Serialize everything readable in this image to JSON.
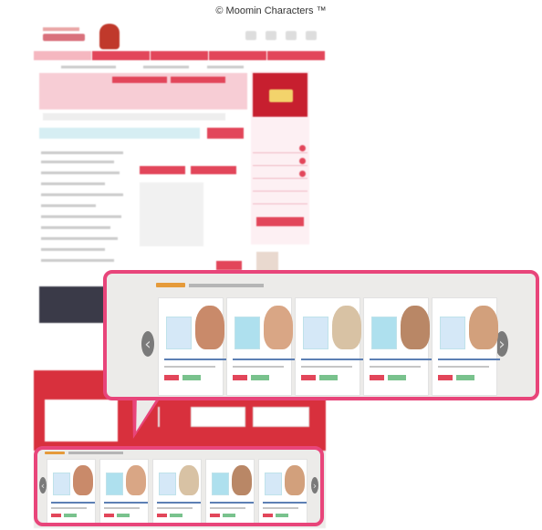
{
  "copyright": "© Moomin Characters ™",
  "colors": {
    "callout_border": "#e8457a",
    "site_red": "#e2465a",
    "panel_bg": "#ecebe9",
    "brand_orange": "#e59a3a"
  },
  "icons": {
    "carousel_prev": "chevron-left-icon",
    "carousel_next": "chevron-right-icon"
  },
  "carousel": {
    "prev_glyph": "‹",
    "next_glyph": "›",
    "card_count": 5
  }
}
